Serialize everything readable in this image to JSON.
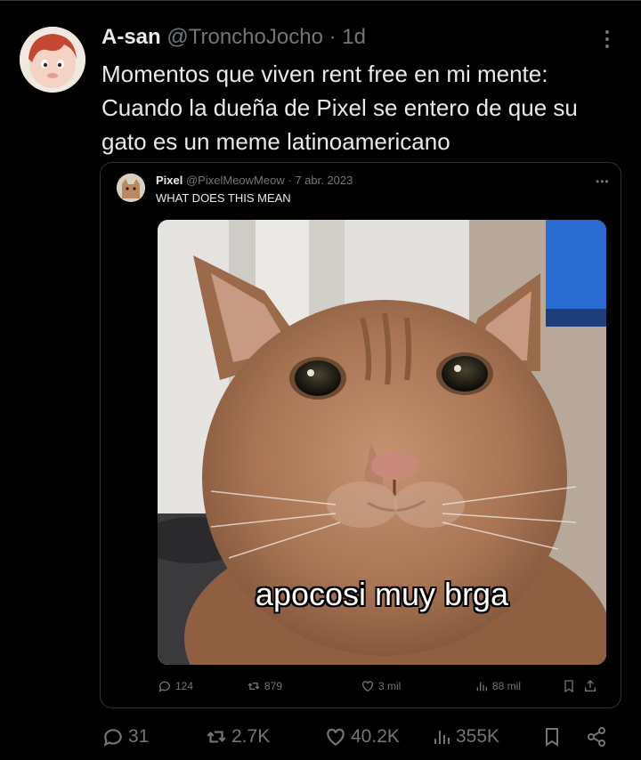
{
  "tweet": {
    "author_name": "A-san",
    "author_handle": "@TronchoJocho",
    "separator": "·",
    "time": "1d",
    "text_lines": [
      "Momentos que viven rent free en mi mente:",
      "Cuando la dueña de Pixel se entero de que su",
      "gato es un meme latinoamericano"
    ],
    "stats": {
      "replies": "31",
      "reposts": "2.7K",
      "likes": "40.2K",
      "views": "355K"
    }
  },
  "quoted": {
    "author_name": "Pixel",
    "author_handle": "@PixelMeowMeow",
    "separator": "·",
    "date": "7 abr. 2023",
    "text": "WHAT DOES THIS MEAN",
    "media_caption": "apocosi muy brga",
    "stats": {
      "replies": "124",
      "reposts": "879",
      "likes": "3 mil",
      "views": "88 mil"
    }
  },
  "icons": {
    "more": "more-vertical-icon",
    "reply": "reply-icon",
    "repost": "repost-icon",
    "like": "heart-icon",
    "views": "views-bar-icon",
    "bookmark": "bookmark-icon",
    "share": "share-icon"
  },
  "colors": {
    "background": "#000000",
    "text": "#e7e9ea",
    "muted": "#71767b",
    "border": "#2f3336"
  }
}
